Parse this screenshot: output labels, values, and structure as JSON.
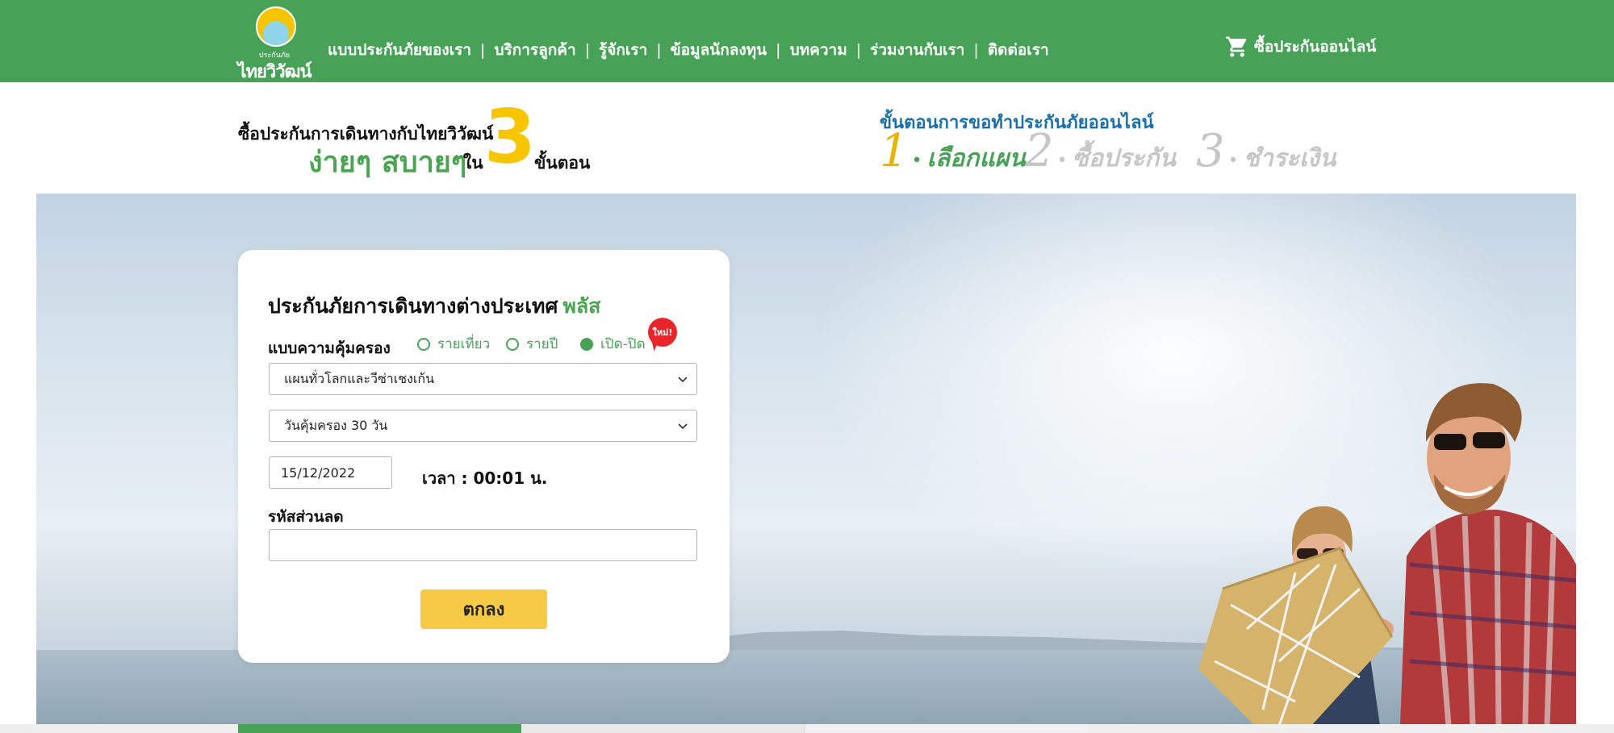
{
  "header": {
    "logo_top": "ประกันภัย",
    "logo_name": "ไทยวิวัฒน์",
    "nav": [
      "แบบประกันภัยของเรา",
      "บริการลูกค้า",
      "รู้จักเรา",
      "ข้อมูลนักลงทุน",
      "บทความ",
      "ร่วมงานกับเรา",
      "ติดต่อเรา"
    ],
    "separator": "|",
    "cart_label": "ซื้อประกันออนไลน์"
  },
  "promo": {
    "line1": "ซื้อประกันการเดินทางกับไทยวิวัฒน์",
    "highlight": "ง่ายๆ สบายๆ",
    "in_word": "ใน",
    "number": "3",
    "steps_word": "ขั้นตอน"
  },
  "steps": {
    "title": "ขั้นตอนการขอทำประกันภัยออนไลน์",
    "items": [
      {
        "num": "1",
        "label": "เลือกแผน",
        "active": true
      },
      {
        "num": "2",
        "label": "ซื้อประกัน",
        "active": false
      },
      {
        "num": "3",
        "label": "ชำระเงิน",
        "active": false
      }
    ],
    "dot": "•"
  },
  "form": {
    "title": "ประกันภัยการเดินทางต่างประเทศ",
    "title_plus": "พลัส",
    "coverage_label": "แบบความคุ้มครอง",
    "options": [
      {
        "label": "รายเที่ยว",
        "checked": false
      },
      {
        "label": "รายปี",
        "checked": false
      },
      {
        "label": "เปิด-ปิด",
        "checked": true
      }
    ],
    "new_badge": "ใหม่!",
    "plan_select": "แผนทั่วโลกและวีซ่าเชงเก้น",
    "days_select": "วันคุ้มครอง 30 วัน",
    "date_value": "15/12/2022",
    "time_text": "เวลา : 00:01 น.",
    "discount_label": "รหัสส่วนลด",
    "discount_value": "",
    "submit_label": "ตกลง"
  },
  "colors": {
    "brand_green": "#47a258",
    "accent_yellow": "#f7c600",
    "steps_blue": "#1b6fa8",
    "badge_red": "#e8262a"
  }
}
